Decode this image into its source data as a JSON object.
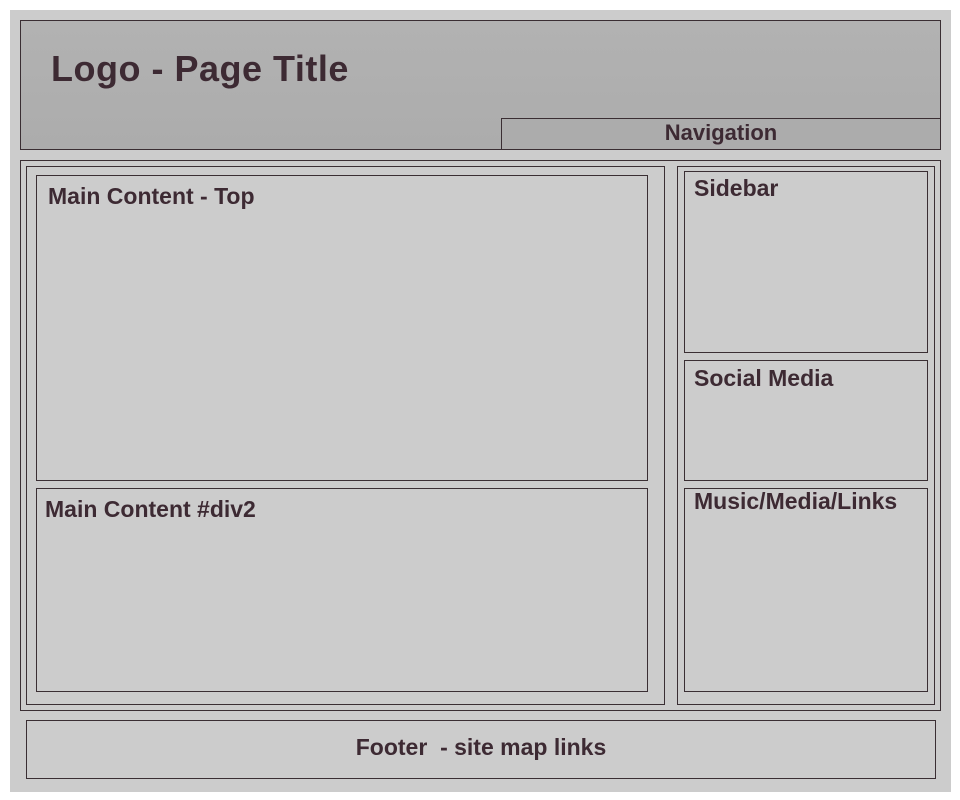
{
  "header": {
    "title": "Logo - Page Title"
  },
  "navigation": {
    "label": "Navigation"
  },
  "main": {
    "top_label": "Main Content - Top",
    "div2_label": "Main Content #div2"
  },
  "side": {
    "sidebar_label": "Sidebar",
    "social_label": "Social Media",
    "music_label": "Music/Media/Links"
  },
  "footer": {
    "label": "Footer  - site map links"
  },
  "colors": {
    "background": "#cccccc",
    "header_fill": "#b0b0b0",
    "border": "#3a2e33",
    "text": "#3d2a33"
  }
}
